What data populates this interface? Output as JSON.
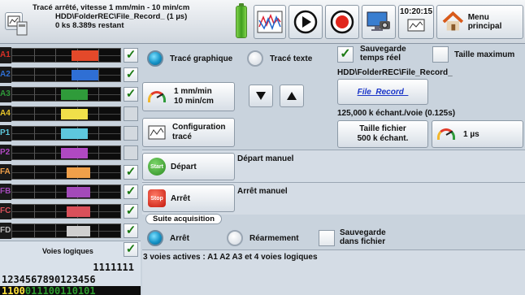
{
  "status": {
    "line1": "Tracé arrêté, vitesse 1 mm/min - 10 min/cm",
    "line2": "HDD\\FolderREC\\File_Record_ (1 µs)",
    "line3": "0 ks 8.389s restant",
    "time": "10:20:15",
    "menu_label": "Menu principal"
  },
  "channels": [
    {
      "label": "A1",
      "color": "#e4492a",
      "bar": [
        0.55,
        0.8
      ],
      "checked": true
    },
    {
      "label": "A2",
      "color": "#2f6fd4",
      "bar": [
        0.55,
        0.8
      ],
      "checked": true
    },
    {
      "label": "A3",
      "color": "#2f9b3a",
      "bar": [
        0.45,
        0.7
      ],
      "checked": true
    },
    {
      "label": "A4",
      "color": "#f0e04a",
      "bar": [
        0.45,
        0.7
      ],
      "checked": false
    },
    {
      "label": "P1",
      "color": "#5ec8dd",
      "bar": [
        0.45,
        0.7
      ],
      "checked": false
    },
    {
      "label": "P2",
      "color": "#b049c2",
      "bar": [
        0.45,
        0.7
      ],
      "checked": false
    },
    {
      "label": "FA",
      "color": "#f0a04a",
      "bar": [
        0.5,
        0.72
      ],
      "checked": true
    },
    {
      "label": "FB",
      "color": "#a34ab9",
      "bar": [
        0.5,
        0.72
      ],
      "checked": true
    },
    {
      "label": "FC",
      "color": "#d9505a",
      "bar": [
        0.5,
        0.72
      ],
      "checked": true
    },
    {
      "label": "FD",
      "color": "#d0d0d0",
      "bar": [
        0.5,
        0.72
      ],
      "checked": true
    }
  ],
  "logic": {
    "title": "Voies logiques",
    "row1": "1111111",
    "row2": "1234567890123456",
    "bits_on": "1100",
    "bits_off": "011100110101"
  },
  "trace": {
    "graph_label": "Tracé graphique",
    "text_label": "Tracé texte",
    "speed_line1": "1 mm/min",
    "speed_line2": "10 min/cm",
    "config_line1": "Configuration",
    "config_line2": "tracé"
  },
  "save": {
    "realtime_line1": "Sauvegarde",
    "realtime_line2": "temps réel",
    "max_size": "Taille maximum",
    "path": "HDD\\FolderREC\\File_Record_",
    "file_button": "File_Record_",
    "sampling": "125,000 k échant./voie (0.125s)",
    "file_size_line1": "Taille fichier",
    "file_size_line2": "500 k échant.",
    "period": "1 µs"
  },
  "start": {
    "icon": "Start",
    "label": "Départ",
    "mode": "Départ manuel"
  },
  "stop": {
    "icon": "Stop",
    "label": "Arrêt",
    "mode": "Arrêt manuel"
  },
  "suite": {
    "title": "Suite acquisition",
    "stop_label": "Arrêt",
    "rearm_label": "Réarmement",
    "save_line1": "Sauvegarde",
    "save_line2": "dans fichier",
    "info": "3 voies actives : A1 A2 A3 et 4 voies logiques"
  }
}
